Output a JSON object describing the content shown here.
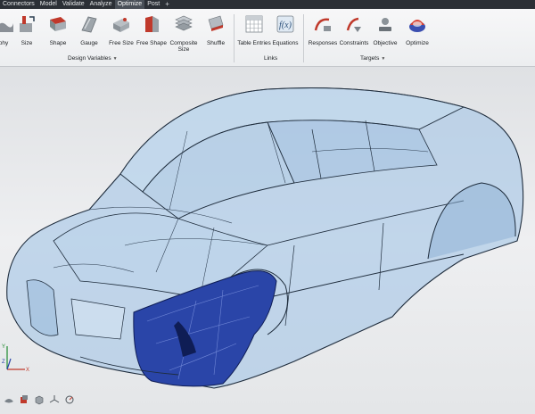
{
  "menubar": {
    "items": [
      "Connectors",
      "Model",
      "Validate",
      "Analyze",
      "Optimize",
      "Post"
    ],
    "active": "Optimize",
    "add_symbol": "+"
  },
  "ribbon": {
    "design_variables": {
      "tools": [
        "phy",
        "Size",
        "Shape",
        "Gauge",
        "Free Size",
        "Free Shape",
        "Composite Size",
        "Shuffle"
      ],
      "label": "Design Variables",
      "caret": "▼"
    },
    "links": {
      "tools": [
        "Table Entries",
        "Equations"
      ],
      "label": "Links"
    },
    "targets": {
      "tools": [
        "Responses",
        "Constraints",
        "Objective",
        "Optimize"
      ],
      "label": "Targets",
      "caret": "▼"
    }
  },
  "triad": {
    "y": "Y",
    "z": "Z",
    "x": "X"
  },
  "colors": {
    "accent": "#c7d845",
    "highlight": "#2a45a8",
    "body_fill": "#a9c8e6"
  }
}
